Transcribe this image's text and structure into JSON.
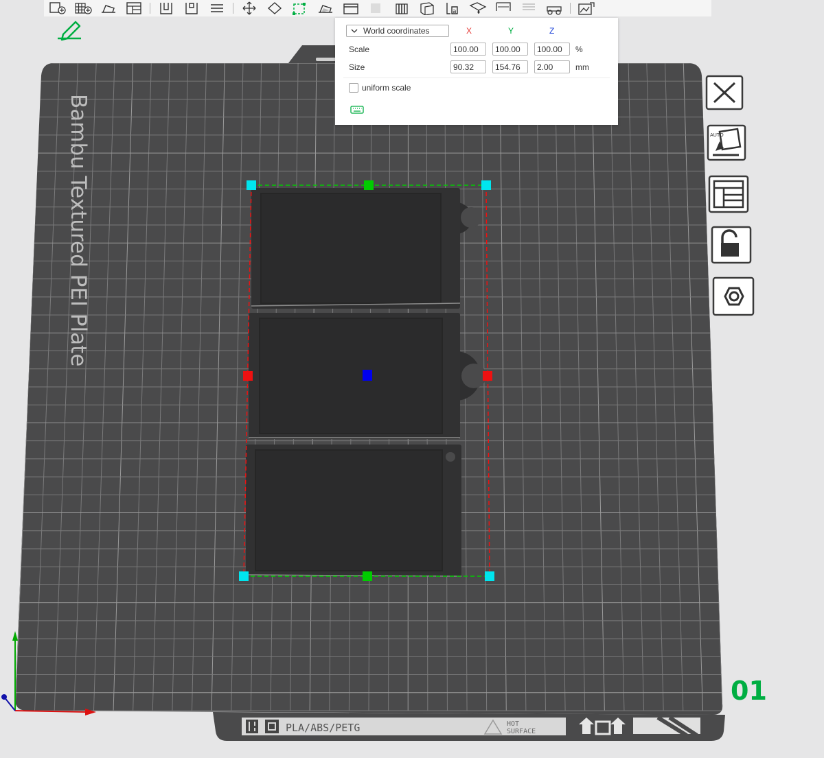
{
  "toolbar": {
    "icons": [
      "add-plate-icon",
      "add-grid-icon",
      "orient-icon",
      "arrange-icon",
      "split-objects-icon",
      "split-parts-icon",
      "layers-icon",
      "move-icon",
      "rotate-icon",
      "scale-icon",
      "lay-on-face-icon",
      "cut-icon",
      "support-paint-icon",
      "seam-paint-icon",
      "text-icon",
      "color-paint-icon",
      "measure-icon",
      "assembly-icon",
      "boolean-icon",
      "variable-layer-icon"
    ]
  },
  "transform_panel": {
    "coordinate_mode": "World coordinates",
    "axes": {
      "x": "X",
      "y": "Y",
      "z": "Z"
    },
    "axis_colors": {
      "x": "#e53935",
      "y": "#00ae42",
      "z": "#1e44d8"
    },
    "scale": {
      "label": "Scale",
      "x": "100.00",
      "y": "100.00",
      "z": "100.00",
      "unit": "%"
    },
    "size": {
      "label": "Size",
      "x": "90.32",
      "y": "154.76",
      "z": "2.00",
      "unit": "mm"
    },
    "uniform_scale": {
      "label": "uniform scale",
      "checked": false
    }
  },
  "plate": {
    "name": "Bambu Textured PEI Plate",
    "number": "01",
    "footer_material": "PLA/ABS/PETG",
    "footer_warning_line1": "HOT",
    "footer_warning_line2": "SURFACE"
  },
  "colors": {
    "accent": "#00ae42",
    "plate": "#4a4a4b",
    "grid": "#8a8a8a",
    "handle_corner": "#00e5ee",
    "handle_x": "#ee1111",
    "handle_y": "#00cc00",
    "handle_center": "#0000ee"
  }
}
